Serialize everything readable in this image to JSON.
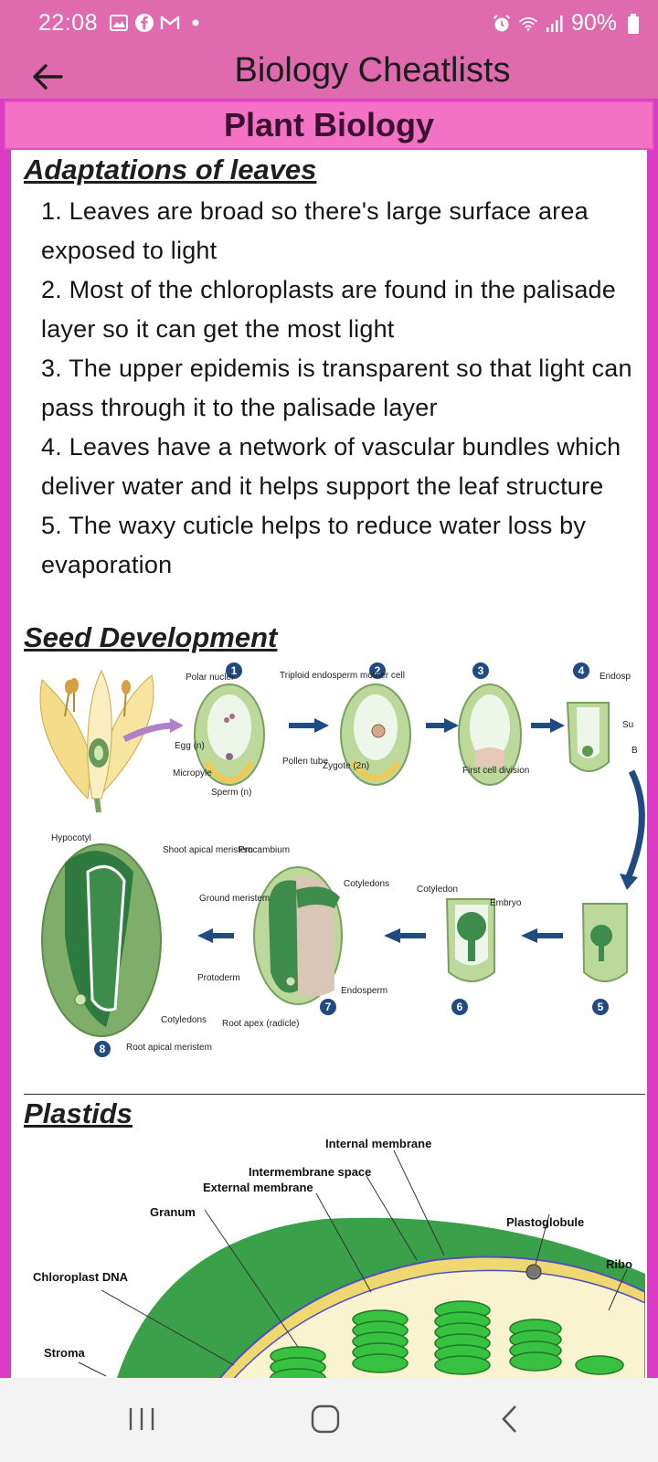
{
  "status_bar": {
    "time": "22:08",
    "battery": "90%",
    "left_icons": [
      "gallery-icon",
      "facebook-icon",
      "gmail-icon",
      "dot-icon"
    ],
    "right_icons": [
      "alarm-icon",
      "wifi-icon",
      "signal-icon",
      "battery-icon"
    ]
  },
  "app_bar": {
    "title": "Biology Cheatlists"
  },
  "section": {
    "title": "Plant Biology"
  },
  "content": {
    "leaves_heading": "Adaptations of leaves",
    "leaves_items": [
      "1. Leaves are broad so there's large surface area exposed to light",
      "2. Most of the chloroplasts are found in the palisade layer so it can get the most light",
      "3. The upper epidemis is transparent so that light can pass through it to the palisade layer",
      "4. Leaves have a network of vascular bundles which deliver water and it helps support the leaf structure",
      "5. The waxy cuticle helps to reduce water loss by evaporation"
    ],
    "seed_heading": "Seed Development",
    "seed_figure": {
      "steps": [
        "1",
        "2",
        "3",
        "4",
        "5",
        "6",
        "7",
        "8"
      ],
      "labels": {
        "polar_nuclei": "Polar nuclei",
        "egg": "Egg (n)",
        "micropyle": "Micropyle",
        "sperm": "Sperm (n)",
        "pollen_tube": "Pollen tube",
        "triploid": "Triploid endosperm mother cell",
        "zygote": "Zygote (2n)",
        "first_division": "First cell division",
        "endosperm_cut": "Endosp",
        "su": "Su",
        "b": "B",
        "hypocotyl": "Hypocotyl",
        "shoot_apical": "Shoot apical meristem",
        "procambium": "Procambium",
        "cotyledons": "Cotyledons",
        "cotyledon": "Cotyledon",
        "embryo": "Embryo",
        "ground_meristem": "Ground meristem",
        "protoderm": "Protoderm",
        "endosperm": "Endosperm",
        "cotyledons_bottom": "Cotyledons",
        "root_apex": "Root apex (radicle)",
        "root_apical": "Root apical meristem"
      }
    },
    "plastids_heading": "Plastids",
    "plastid_figure": {
      "labels": {
        "internal_membrane": "Internal membrane",
        "intermembrane_space": "Intermembrane space",
        "external_membrane": "External membrane",
        "granum": "Granum",
        "plastoglobule": "Plastoglobule",
        "ribo": "Ribo",
        "chloroplast_dna": "Chloroplast DNA",
        "stroma": "Stroma"
      }
    }
  },
  "nav_bar": {
    "buttons": [
      "recent-apps",
      "home",
      "back"
    ]
  }
}
